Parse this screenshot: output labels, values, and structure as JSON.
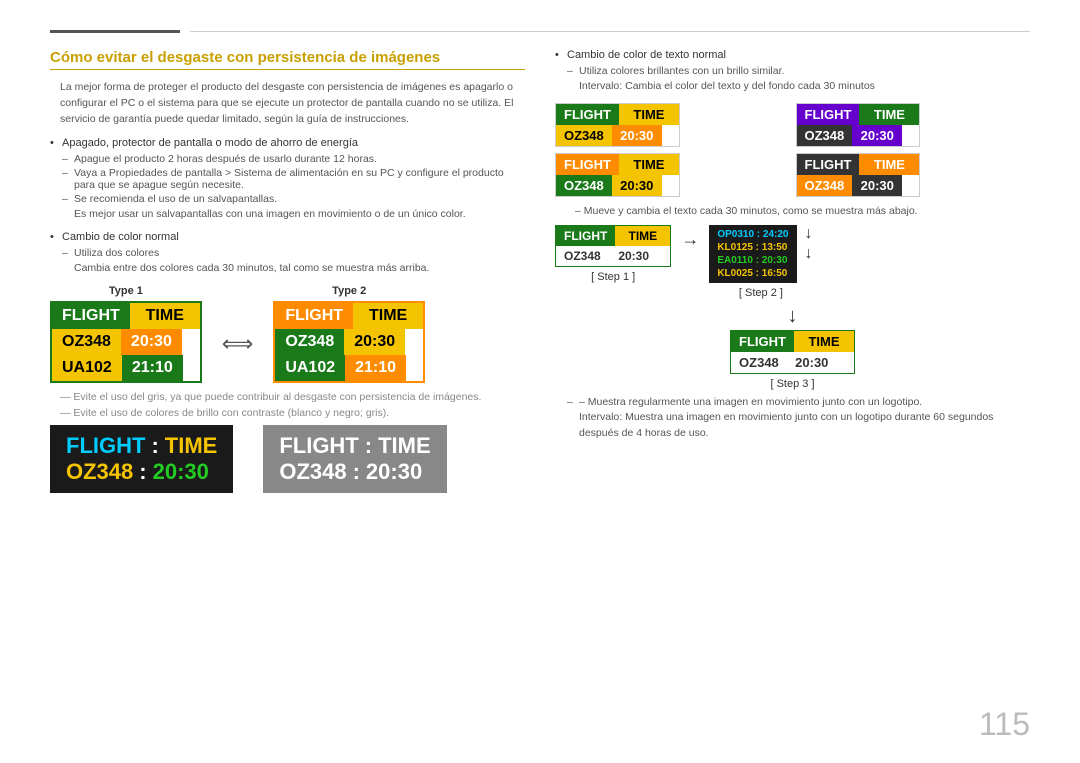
{
  "page": {
    "number": "115"
  },
  "header": {
    "title": "Cómo evitar el desgaste con persistencia de imágenes"
  },
  "intro": {
    "text": "La mejor forma de proteger el producto del desgaste con persistencia de imágenes es apagarlo o configurar el PC o el sistema para que se ejecute un protector de pantalla cuando no se utiliza. El servicio de garantía puede quedar limitado, según la guía de instrucciones."
  },
  "bullets": {
    "b1": "Apagado, protector de pantalla o modo de ahorro de energía",
    "b1_s1": "Apague el producto 2 horas después de usarlo durante 12 horas.",
    "b1_s2": "Vaya a Propiedades de pantalla > Sistema de alimentación en su PC y configure el producto para que se apague según necesite.",
    "b1_s3": "Se recomienda el uso de un salvapantallas.",
    "b1_s4": "Es mejor usar un salvapantallas con una imagen en movimiento o de un único color.",
    "b2": "Cambio de color normal",
    "b2_s1": "Utiliza dos colores",
    "b2_s2": "Cambia entre dos colores cada 30 minutos, tal como se muestra más arriba.",
    "type1_label": "Type 1",
    "type2_label": "Type 2"
  },
  "flight_boards": {
    "flight": "FLIGHT",
    "time": "TIME",
    "colon": ":",
    "oz348": "OZ348",
    "t2030": "20:30",
    "ua102": "UA102",
    "t2110": "21:10"
  },
  "right_col": {
    "b1": "Cambio de color de texto normal",
    "b1_s1": "Utiliza colores brillantes con un brillo similar.",
    "b1_s2": "Intervalo: Cambia el color del texto y del fondo cada 30 minutos",
    "b2_desc": "– Mueve y cambia el texto cada 30 minutos, como se muestra más abajo.",
    "step1": "[ Step 1 ]",
    "step2": "[ Step 2 ]",
    "step3": "[ Step 3 ]",
    "scroll_rows": [
      {
        "text": "OP0310 : 24:20",
        "color": "cyan"
      },
      {
        "text": "KL0125 : 13:50",
        "color": "yellow"
      },
      {
        "text": "EA0110 : 20:30",
        "color": "green"
      },
      {
        "text": "KL0025 : 16:50",
        "color": "yellow"
      }
    ],
    "b3": "– Muestra regularmente una imagen en movimiento junto con un logotipo.",
    "b3_s1": "Intervalo: Muestra una imagen en movimiento junto con un logotipo durante 60 segundos después de 4 horas de uso."
  },
  "bottom_boards": {
    "b1_flight": "FLIGHT",
    "b1_colon": ":",
    "b1_time": "TIME",
    "b1_oz": "OZ348",
    "b1_t": "20:30",
    "b2_flight": "FLIGHT",
    "b2_colon": ":",
    "b2_time": "TIME",
    "b2_oz": "OZ348",
    "b2_t": "20:30"
  },
  "bottom_notes": {
    "dash1": "— Evite el uso del gris, ya que puede contribuir al desgaste con persistencia de imágenes.",
    "dash2": "— Evite el uso de colores de brillo con contraste (blanco y negro; gris)."
  }
}
